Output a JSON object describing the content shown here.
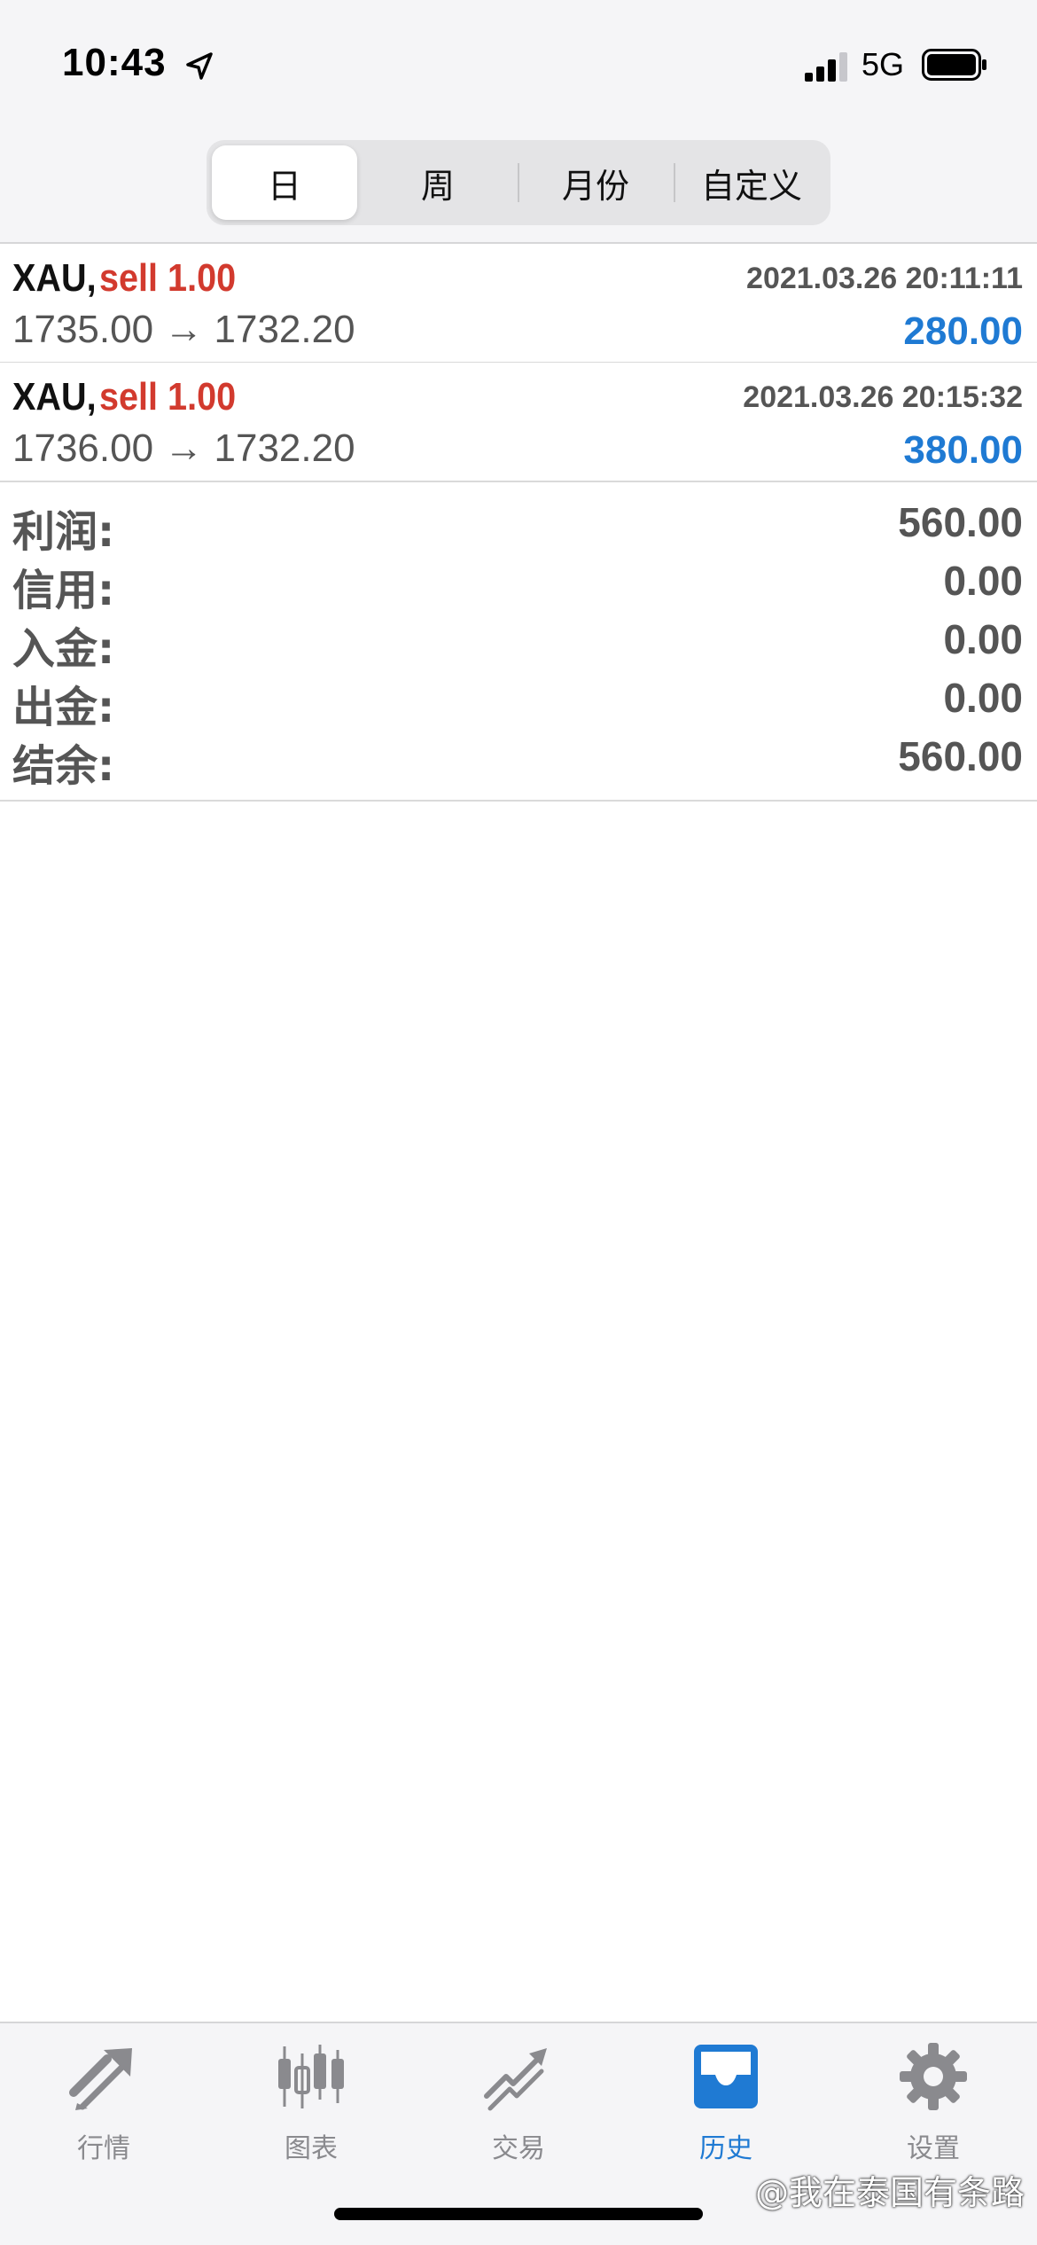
{
  "status_bar": {
    "time": "10:43",
    "network": "5G"
  },
  "period_tabs": [
    {
      "label": "日",
      "selected": true
    },
    {
      "label": "周",
      "selected": false
    },
    {
      "label": "月份",
      "selected": false
    },
    {
      "label": "自定义",
      "selected": false
    }
  ],
  "trades": [
    {
      "symbol": "XAU,",
      "type": "sell 1.00",
      "datetime": "2021.03.26 20:11:11",
      "prices": "1735.00 → 1732.20",
      "profit": "280.00"
    },
    {
      "symbol": "XAU,",
      "type": "sell 1.00",
      "datetime": "2021.03.26 20:15:32",
      "prices": "1736.00 → 1732.20",
      "profit": "380.00"
    }
  ],
  "summary": [
    {
      "label": "利润:",
      "value": "560.00"
    },
    {
      "label": "信用:",
      "value": "0.00"
    },
    {
      "label": "入金:",
      "value": "0.00"
    },
    {
      "label": "出金:",
      "value": "0.00"
    },
    {
      "label": "结余:",
      "value": "560.00"
    }
  ],
  "tabbar": [
    {
      "label": "行情",
      "icon": "quotes-icon",
      "active": false
    },
    {
      "label": "图表",
      "icon": "chart-icon",
      "active": false
    },
    {
      "label": "交易",
      "icon": "trade-icon",
      "active": false
    },
    {
      "label": "历史",
      "icon": "history-icon",
      "active": true
    },
    {
      "label": "设置",
      "icon": "settings-icon",
      "active": false
    }
  ],
  "watermark": "@我在泰国有条路",
  "colors": {
    "sell": "#d23a2e",
    "profit": "#1f7ad3",
    "active_tab": "#1f7ad3",
    "inactive_tab": "#8a8a8e"
  }
}
